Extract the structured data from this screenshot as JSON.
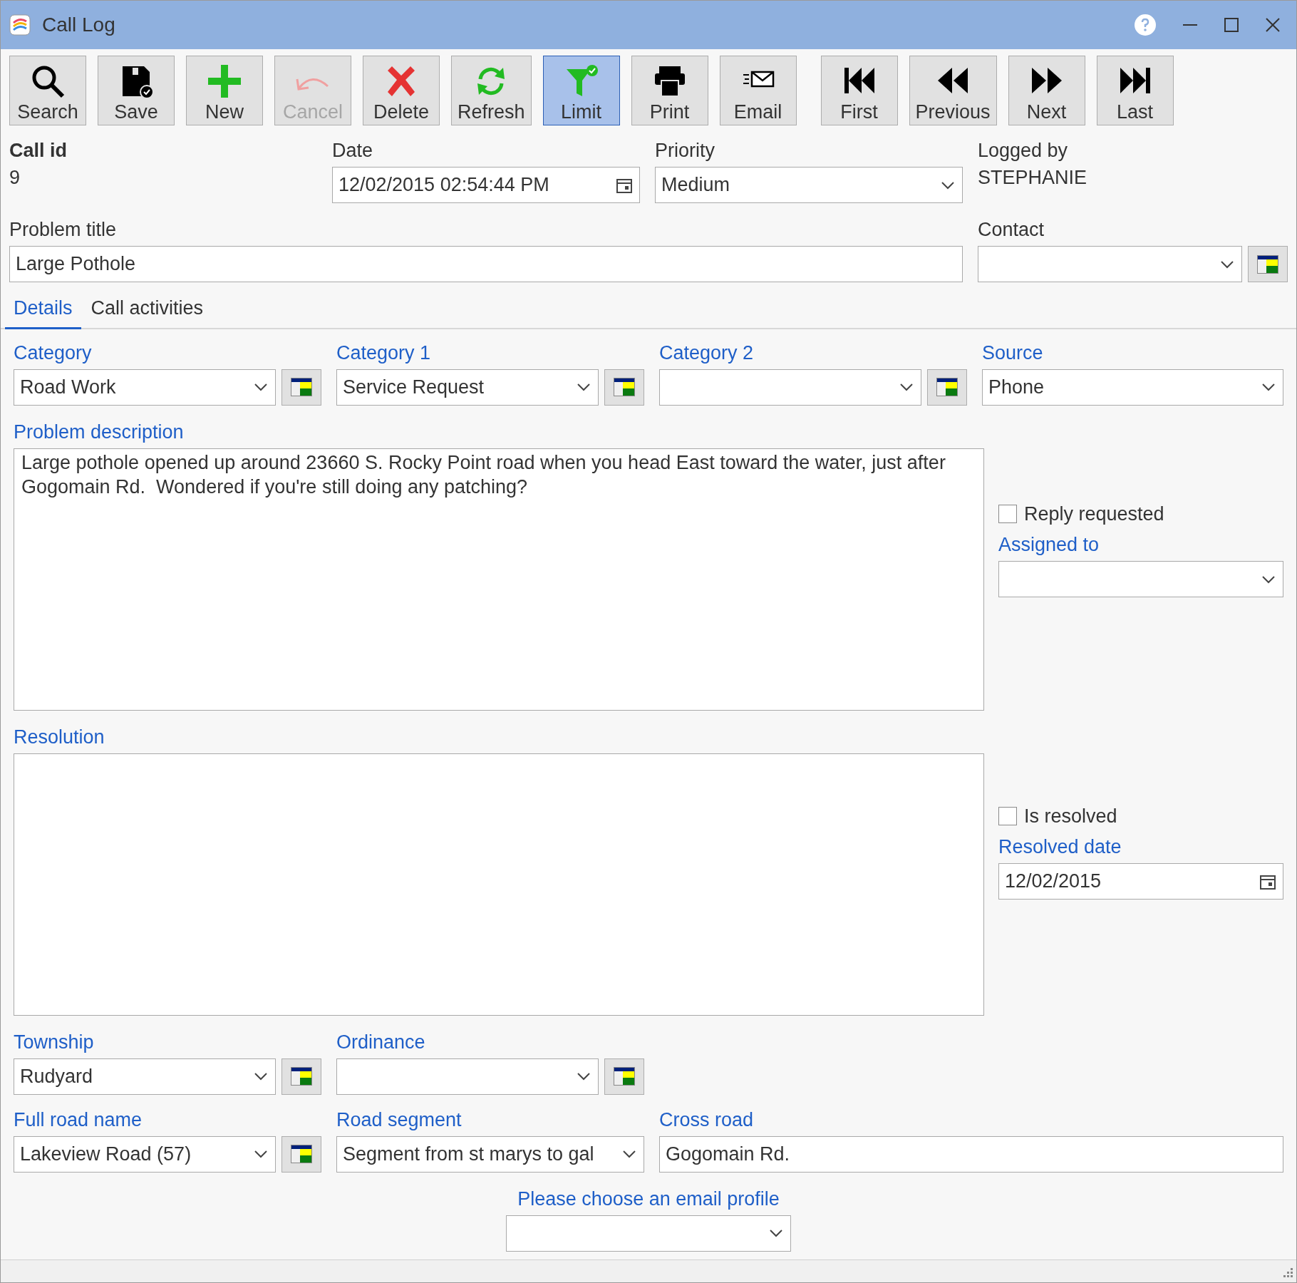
{
  "window": {
    "title": "Call Log"
  },
  "toolbar": {
    "groups": [
      [
        {
          "label": "Search",
          "disabled": false,
          "selected": false
        },
        {
          "label": "Save",
          "disabled": false,
          "selected": false
        },
        {
          "label": "New",
          "disabled": false,
          "selected": false
        },
        {
          "label": "Cancel",
          "disabled": true,
          "selected": false
        },
        {
          "label": "Delete",
          "disabled": false,
          "selected": false
        },
        {
          "label": "Refresh",
          "disabled": false,
          "selected": false
        },
        {
          "label": "Limit",
          "disabled": false,
          "selected": true
        },
        {
          "label": "Print",
          "disabled": false,
          "selected": false
        },
        {
          "label": "Email",
          "disabled": false,
          "selected": false
        }
      ],
      [
        {
          "label": "First",
          "disabled": false,
          "selected": false
        },
        {
          "label": "Previous",
          "disabled": false,
          "selected": false
        },
        {
          "label": "Next",
          "disabled": false,
          "selected": false
        },
        {
          "label": "Last",
          "disabled": false,
          "selected": false
        }
      ]
    ]
  },
  "header": [
    {
      "label": "Call id",
      "value": "9",
      "kind": "static_bold"
    },
    {
      "label": "Date",
      "value": "12/02/2015 02:54:44 PM",
      "kind": "date"
    },
    {
      "label": "Priority",
      "value": "Medium",
      "kind": "combo"
    },
    {
      "label": "Logged by",
      "value": "STEPHANIE",
      "kind": "static"
    }
  ],
  "problem_title": {
    "label": "Problem title",
    "value": "Large Pothole",
    "kind": "text"
  },
  "contact": {
    "label": "Contact",
    "kind": "combo_lookup"
  },
  "tabs": [
    {
      "label": "Details",
      "selected": true
    },
    {
      "label": "Call activities",
      "selected": false
    }
  ],
  "details": {
    "category_row": [
      {
        "label": "Category",
        "value": "Road Work",
        "kind": "combo_lookup"
      },
      {
        "label": "Category 1",
        "value": "Service Request",
        "kind": "combo_lookup"
      },
      {
        "label": "Category 2",
        "kind": "combo_lookup"
      },
      {
        "label": "Source",
        "value": "Phone",
        "kind": "combo"
      }
    ],
    "problem_description": {
      "label": "Problem description",
      "value": "Large pothole opened up around 23660 S. Rocky Point road when you head East toward the water, just after Gogomain Rd.  Wondered if you're still doing any patching?"
    },
    "reply_requested": {
      "label": "Reply requested",
      "checked": false
    },
    "assigned_to": {
      "label": "Assigned to",
      "kind": "combo"
    },
    "resolution": {
      "label": "Resolution"
    },
    "is_resolved": {
      "label": "Is resolved",
      "checked": false
    },
    "resolved_date": {
      "label": "Resolved date",
      "value": "12/02/2015",
      "kind": "date"
    },
    "township_row": [
      {
        "label": "Township",
        "value": "Rudyard",
        "kind": "combo_lookup"
      },
      {
        "label": "Ordinance",
        "kind": "combo_lookup"
      }
    ],
    "road_row": [
      {
        "label": "Full road name",
        "value": "Lakeview Road (57)",
        "kind": "combo_lookup"
      },
      {
        "label": "Road segment",
        "value": "Segment from st marys to gal",
        "kind": "combo"
      },
      {
        "label": "Cross road",
        "value": "Gogomain Rd.",
        "kind": "text"
      }
    ],
    "email_profile": {
      "label": "Please choose an email profile",
      "kind": "combo"
    }
  }
}
